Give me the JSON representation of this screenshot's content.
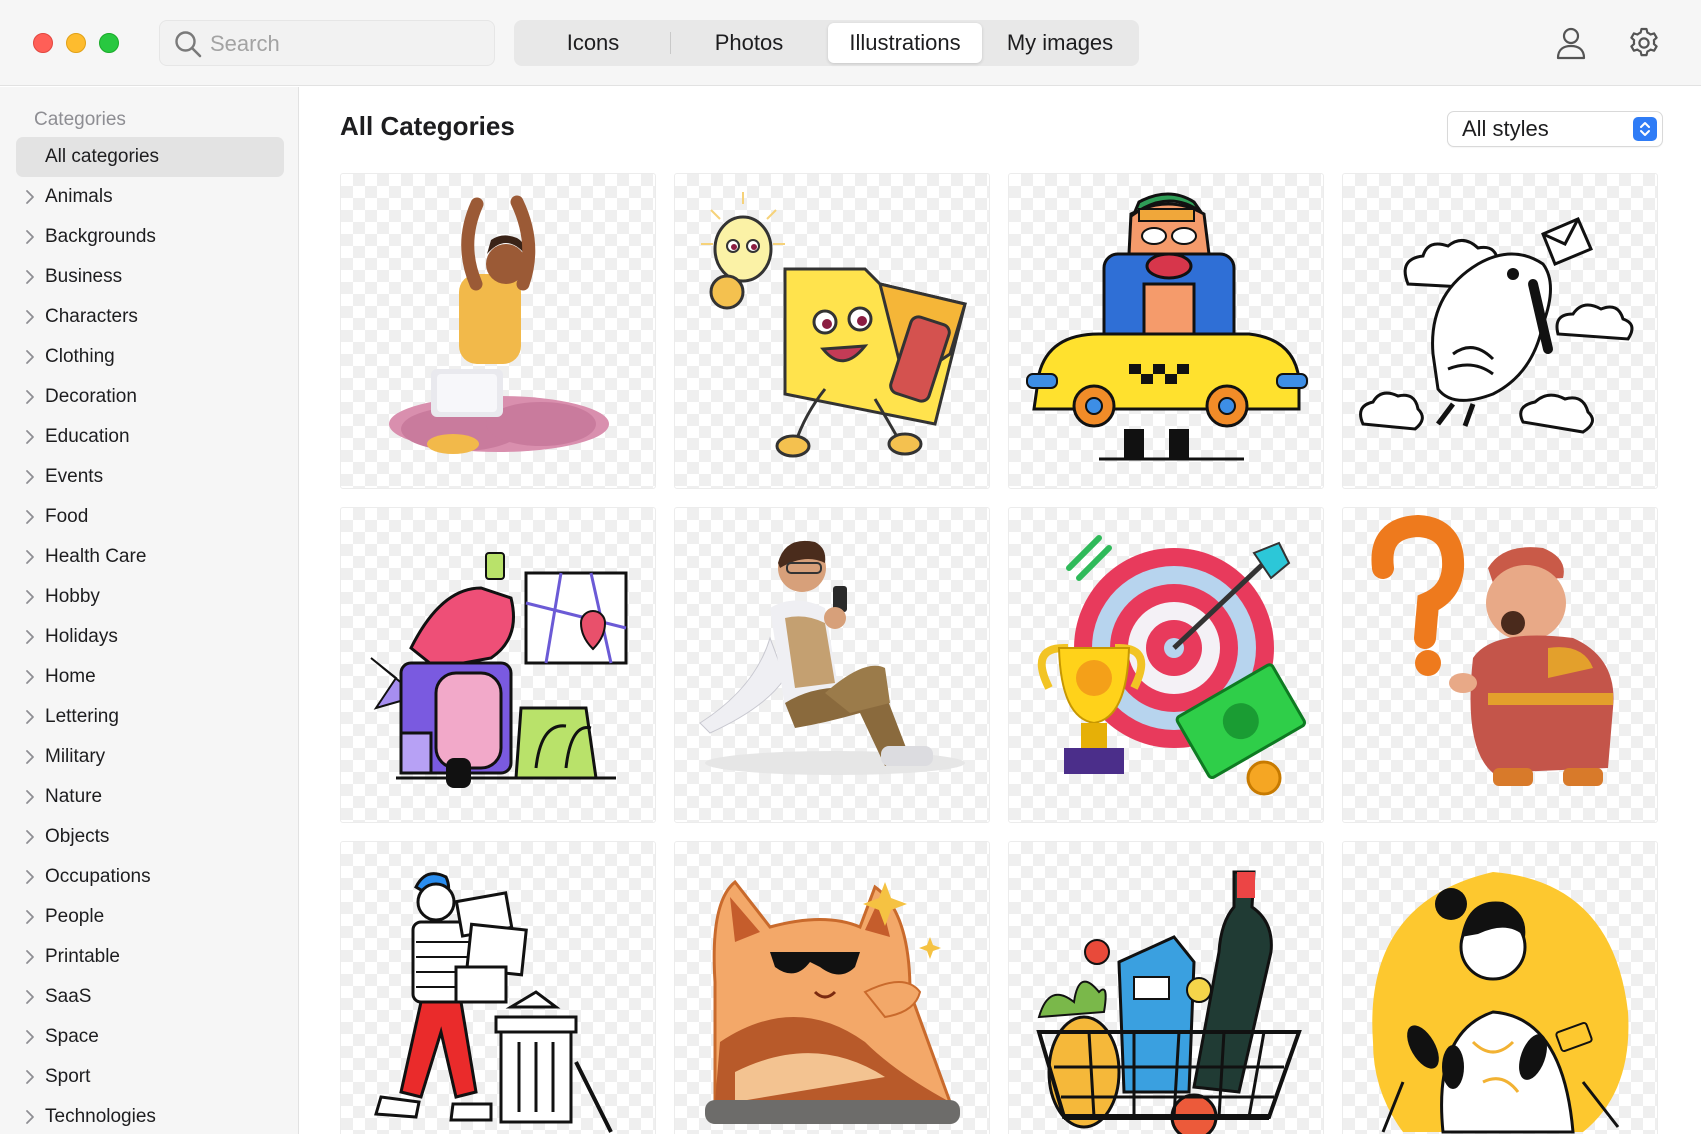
{
  "search": {
    "placeholder": "Search"
  },
  "tabs": [
    {
      "label": "Icons"
    },
    {
      "label": "Photos"
    },
    {
      "label": "Illustrations",
      "selected": true
    },
    {
      "label": "My images"
    }
  ],
  "toolbar": {
    "account_icon": "person-icon",
    "settings_icon": "gear-icon"
  },
  "sidebar": {
    "heading": "Categories",
    "items": [
      {
        "label": "All categories",
        "selected": true
      },
      {
        "label": "Animals"
      },
      {
        "label": "Backgrounds"
      },
      {
        "label": "Business"
      },
      {
        "label": "Characters"
      },
      {
        "label": "Clothing"
      },
      {
        "label": "Decoration"
      },
      {
        "label": "Education"
      },
      {
        "label": "Events"
      },
      {
        "label": "Food"
      },
      {
        "label": "Health Care"
      },
      {
        "label": "Hobby"
      },
      {
        "label": "Holidays"
      },
      {
        "label": "Home"
      },
      {
        "label": "Lettering"
      },
      {
        "label": "Military"
      },
      {
        "label": "Nature"
      },
      {
        "label": "Objects"
      },
      {
        "label": "Occupations"
      },
      {
        "label": "People"
      },
      {
        "label": "Printable"
      },
      {
        "label": "SaaS"
      },
      {
        "label": "Space"
      },
      {
        "label": "Sport"
      },
      {
        "label": "Technologies"
      }
    ]
  },
  "main": {
    "title": "All Categories",
    "style_filter": {
      "value": "All styles"
    },
    "illustrations": [
      {
        "subject": "woman-doing-yoga-stretch-with-laptop"
      },
      {
        "subject": "folder-character-with-lightbulb"
      },
      {
        "subject": "cartoon-man-in-yellow-taxi"
      },
      {
        "subject": "bird-with-envelope-and-clouds"
      },
      {
        "subject": "courier-on-scooter-with-map"
      },
      {
        "subject": "man-sitting-with-phone"
      },
      {
        "subject": "target-trophy-and-money"
      },
      {
        "subject": "thinking-man-with-question-mark"
      },
      {
        "subject": "man-carrying-boxes-to-trash"
      },
      {
        "subject": "cat-with-sunglasses"
      },
      {
        "subject": "grocery-basket"
      },
      {
        "subject": "woman-with-microphones"
      }
    ]
  },
  "colors": {
    "accent": "#2f7cf6",
    "window_red": "#ff5f57",
    "window_yellow": "#febc2e",
    "window_green": "#28c840"
  }
}
